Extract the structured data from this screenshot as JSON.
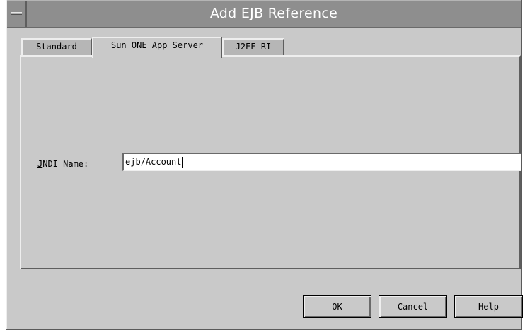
{
  "window": {
    "title": "Add EJB Reference"
  },
  "tabs": [
    {
      "label": "Standard",
      "active": false
    },
    {
      "label": "Sun ONE App Server",
      "active": true
    },
    {
      "label": "J2EE RI",
      "active": false
    }
  ],
  "form": {
    "jndi_label_mnemonic": "J",
    "jndi_label_rest": "NDI Name:",
    "jndi_value": "ejb/Account"
  },
  "buttons": {
    "ok_label": "OK",
    "cancel_label": "Cancel",
    "help_label": "Help"
  },
  "colors": {
    "window_bg": "#c9c9c9",
    "titlebar_bg": "#8e8e8e",
    "input_bg": "#ffffff"
  }
}
